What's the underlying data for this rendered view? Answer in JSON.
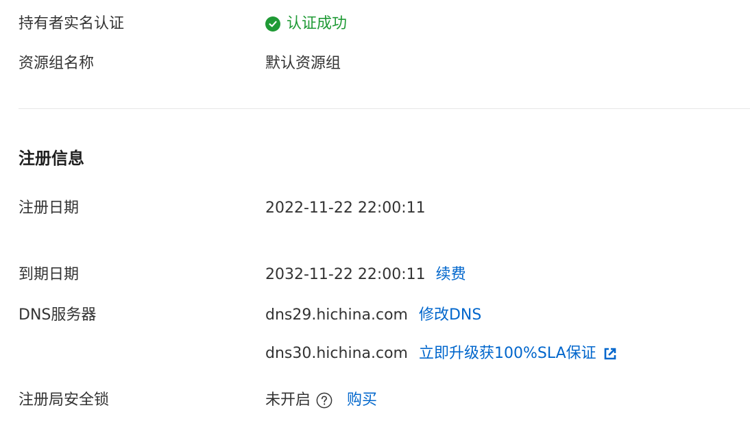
{
  "owner_verification": {
    "label": "持有者实名认证",
    "status": "认证成功",
    "status_icon": "check-circle-icon",
    "status_color": "#1f9a35"
  },
  "resource_group": {
    "label": "资源组名称",
    "value": "默认资源组"
  },
  "registration_section": {
    "title": "注册信息"
  },
  "registration_date": {
    "label": "注册日期",
    "value": "2022-11-22 22:00:11"
  },
  "expiry_date": {
    "label": "到期日期",
    "value": "2032-11-22 22:00:11",
    "renew_link": "续费"
  },
  "dns": {
    "label": "DNS服务器",
    "server1": "dns29.hichina.com",
    "modify_link": "修改DNS",
    "server2": "dns30.hichina.com",
    "upgrade_link": "立即升级获100%SLA保证",
    "upgrade_icon": "external-link-icon"
  },
  "registry_lock": {
    "label": "注册局安全锁",
    "status": "未开启",
    "help_icon": "question-circle-icon",
    "buy_link": "购买"
  },
  "colors": {
    "link": "#0066cc",
    "success": "#1f9a35",
    "text": "#333333"
  }
}
